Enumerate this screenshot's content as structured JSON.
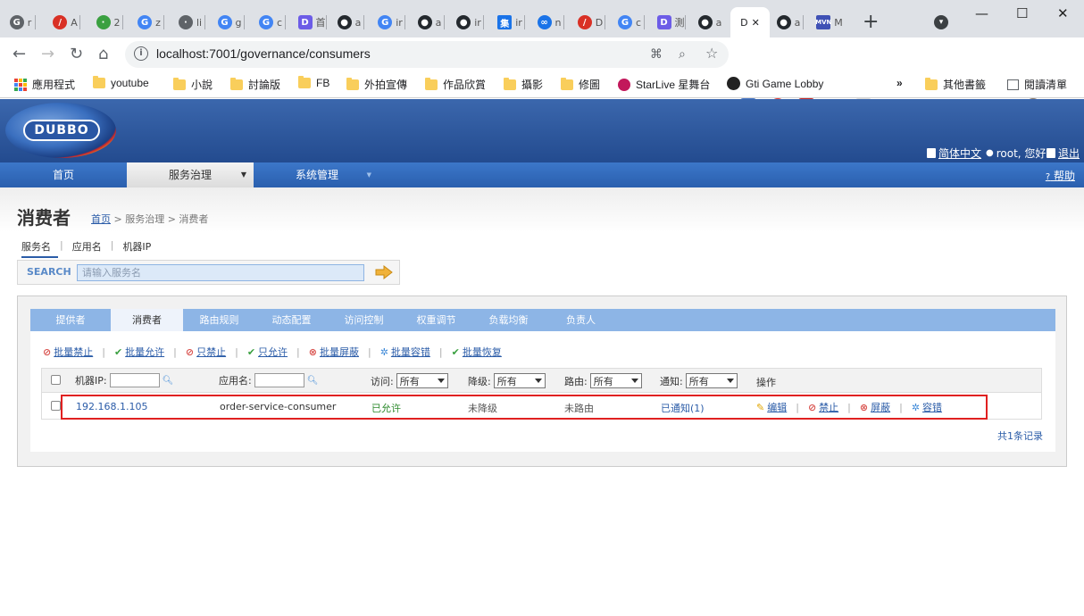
{
  "browser": {
    "tabs": [
      {
        "letter": "r",
        "color": "#5f6368"
      },
      {
        "letter": "A",
        "color": "#d93025"
      },
      {
        "letter": "2",
        "color": "#3aa040"
      },
      {
        "letter": "z",
        "color": "#4285f4"
      },
      {
        "letter": "li",
        "color": "#5f6368"
      },
      {
        "letter": "g",
        "color": "#4285f4"
      },
      {
        "letter": "c",
        "color": "#4285f4"
      },
      {
        "letter": "首",
        "color": "#6c5ce7"
      },
      {
        "letter": "a",
        "color": "#24292e"
      },
      {
        "letter": "ir",
        "color": "#4285f4"
      },
      {
        "letter": "a",
        "color": "#24292e"
      },
      {
        "letter": "ir",
        "color": "#24292e"
      },
      {
        "letter": "ir",
        "color": "#1a73e8"
      },
      {
        "letter": "n",
        "color": "#1a73e8"
      },
      {
        "letter": "D",
        "color": "#d93025"
      },
      {
        "letter": "c",
        "color": "#4285f4"
      },
      {
        "letter": "測",
        "color": "#6c5ce7"
      },
      {
        "letter": "a",
        "color": "#24292e"
      },
      {
        "letter": "D",
        "color": "#5f6368",
        "active": true
      },
      {
        "letter": "a",
        "color": "#24292e"
      },
      {
        "letter": "M",
        "color": "#3f51b5"
      }
    ],
    "new_tab": "+",
    "url": "localhost:7001/governance/consumers",
    "bookmarks": [
      {
        "label": "應用程式",
        "kind": "apps"
      },
      {
        "label": "youtube",
        "kind": "folder"
      },
      {
        "label": "小說",
        "kind": "folder"
      },
      {
        "label": "討論版",
        "kind": "folder"
      },
      {
        "label": "FB",
        "kind": "folder"
      },
      {
        "label": "外拍宣傳",
        "kind": "folder"
      },
      {
        "label": "作品欣賞",
        "kind": "folder"
      },
      {
        "label": "攝影",
        "kind": "folder"
      },
      {
        "label": "修圖",
        "kind": "folder"
      },
      {
        "label": "StarLive 星舞台",
        "kind": "site"
      },
      {
        "label": "Gti Game Lobby",
        "kind": "site"
      }
    ],
    "bookmarks_more": "»",
    "other_bookmarks": "其他書籤",
    "reading_list": "閱讀清單"
  },
  "header": {
    "logo": "DUBBO",
    "language": "简体中文",
    "user": "root, 您好",
    "logout": "退出"
  },
  "nav": {
    "items": [
      "首页",
      "服务治理",
      "系统管理"
    ],
    "help": "帮助"
  },
  "page": {
    "title": "消费者",
    "breadcrumb_home": "首页",
    "breadcrumb_rest": "> 服务治理 > 消费者"
  },
  "search": {
    "tabs": [
      "服务名",
      "应用名",
      "机器IP"
    ],
    "label": "SEARCH",
    "placeholder": "请输入服务名"
  },
  "content_tabs": [
    "提供者",
    "消费者",
    "路由规则",
    "动态配置",
    "访问控制",
    "权重调节",
    "负载均衡",
    "负责人"
  ],
  "actions": [
    {
      "label": "批量禁止",
      "icon": "ban-icon"
    },
    {
      "label": "批量允许",
      "icon": "check-icon"
    },
    {
      "label": "只禁止",
      "icon": "ban-icon"
    },
    {
      "label": "只允许",
      "icon": "check-icon"
    },
    {
      "label": "批量屏蔽",
      "icon": "block-icon"
    },
    {
      "label": "批量容错",
      "icon": "gear-icon"
    },
    {
      "label": "批量恢复",
      "icon": "check-icon"
    }
  ],
  "table": {
    "headers": {
      "ip": "机器IP:",
      "app": "应用名:",
      "access": "访问:",
      "degrade": "降级:",
      "route": "路由:",
      "notify": "通知:",
      "ops": "操作"
    },
    "filter_value": "所有",
    "rows": [
      {
        "ip": "192.168.1.105",
        "app": "order-service-consumer",
        "access": "已允许",
        "degrade": "未降级",
        "route": "未路由",
        "notify": "已通知(1)",
        "ops": [
          "编辑",
          "禁止",
          "屏蔽",
          "容错"
        ]
      }
    ],
    "total": "共1条记录"
  }
}
